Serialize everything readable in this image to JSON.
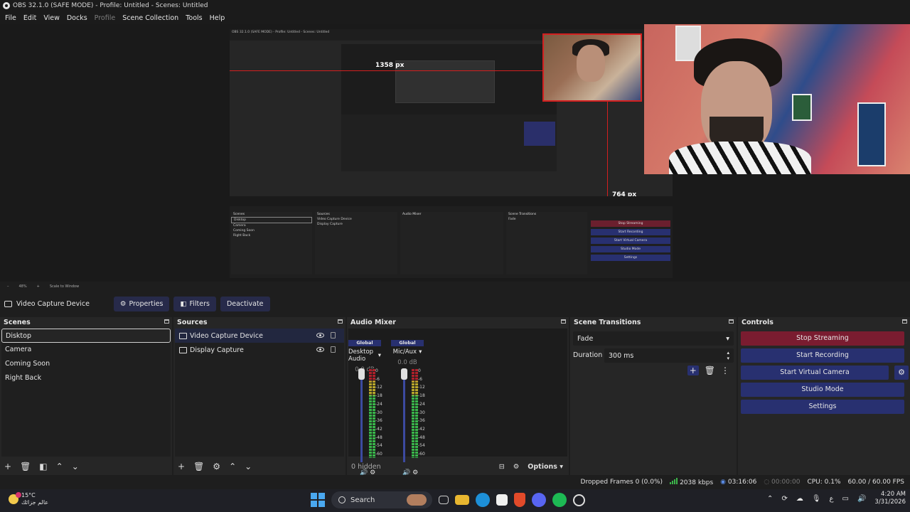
{
  "window": {
    "title": "OBS 32.1.0 (SAFE MODE) - Profile: Untitled - Scenes: Untitled"
  },
  "menu": [
    {
      "label": "File",
      "enabled": true
    },
    {
      "label": "Edit",
      "enabled": true
    },
    {
      "label": "View",
      "enabled": true
    },
    {
      "label": "Docks",
      "enabled": true
    },
    {
      "label": "Profile",
      "enabled": false
    },
    {
      "label": "Scene Collection",
      "enabled": true
    },
    {
      "label": "Tools",
      "enabled": true
    },
    {
      "label": "Help",
      "enabled": true
    }
  ],
  "preview": {
    "measure_horizontal": "1358 px",
    "measure_vertical": "764 px",
    "nested_title": "OBS 32.1.0 (SAFE MODE) - Profile: Untitled - Scenes: Untitled",
    "zoom_percent": "48%",
    "zoom_mode": "Scale to Window"
  },
  "context_bar": {
    "source_name": "Video Capture Device",
    "properties_label": "Properties",
    "filters_label": "Filters",
    "deactivate_label": "Deactivate"
  },
  "scenes": {
    "title": "Scenes",
    "items": [
      "Disktop",
      "Camera",
      "Coming Soon",
      "Right Back"
    ],
    "selected_index": 0
  },
  "sources": {
    "title": "Sources",
    "items": [
      {
        "label": "Video Capture Device",
        "icon": "camera-icon",
        "selected": true
      },
      {
        "label": "Display Capture",
        "icon": "monitor-icon",
        "selected": false
      }
    ]
  },
  "audio_mixer": {
    "title": "Audio Mixer",
    "channels": [
      {
        "badge": "Global",
        "name": "Desktop Audio",
        "db": "0.0 dB"
      },
      {
        "badge": "Global",
        "name": "Mic/Aux",
        "db": "0.0 dB"
      }
    ],
    "scale": [
      "0",
      "-6",
      "-12",
      "-18",
      "-24",
      "-30",
      "-36",
      "-42",
      "-48",
      "-54",
      "-60"
    ],
    "hidden_label": "0 hidden",
    "options_label": "Options"
  },
  "scene_transitions": {
    "title": "Scene Transitions",
    "transition": "Fade",
    "duration_label": "Duration",
    "duration_value": "300 ms"
  },
  "controls": {
    "title": "Controls",
    "stop_streaming": "Stop Streaming",
    "start_recording": "Start Recording",
    "start_virtual_camera": "Start Virtual Camera",
    "studio_mode": "Studio Mode",
    "settings": "Settings"
  },
  "status_bar": {
    "dropped_frames": "Dropped Frames 0 (0.0%)",
    "bitrate": "2038 kbps",
    "stream_time": "03:16:06",
    "record_time": "00:00:00",
    "cpu": "CPU: 0.1%",
    "fps": "60.00 / 60.00 FPS"
  },
  "taskbar": {
    "weather_temp": "15°C",
    "weather_desc": "عالم جزائك",
    "search_placeholder": "Search",
    "clock_time": "4:20 AM",
    "clock_date": "3/31/2026",
    "lang_indicator": "ع"
  },
  "colors": {
    "accent_blue": "#283070",
    "stop_red": "#7a1c30",
    "meter_green": "#39b54a",
    "measure_red": "#d31f1f"
  }
}
